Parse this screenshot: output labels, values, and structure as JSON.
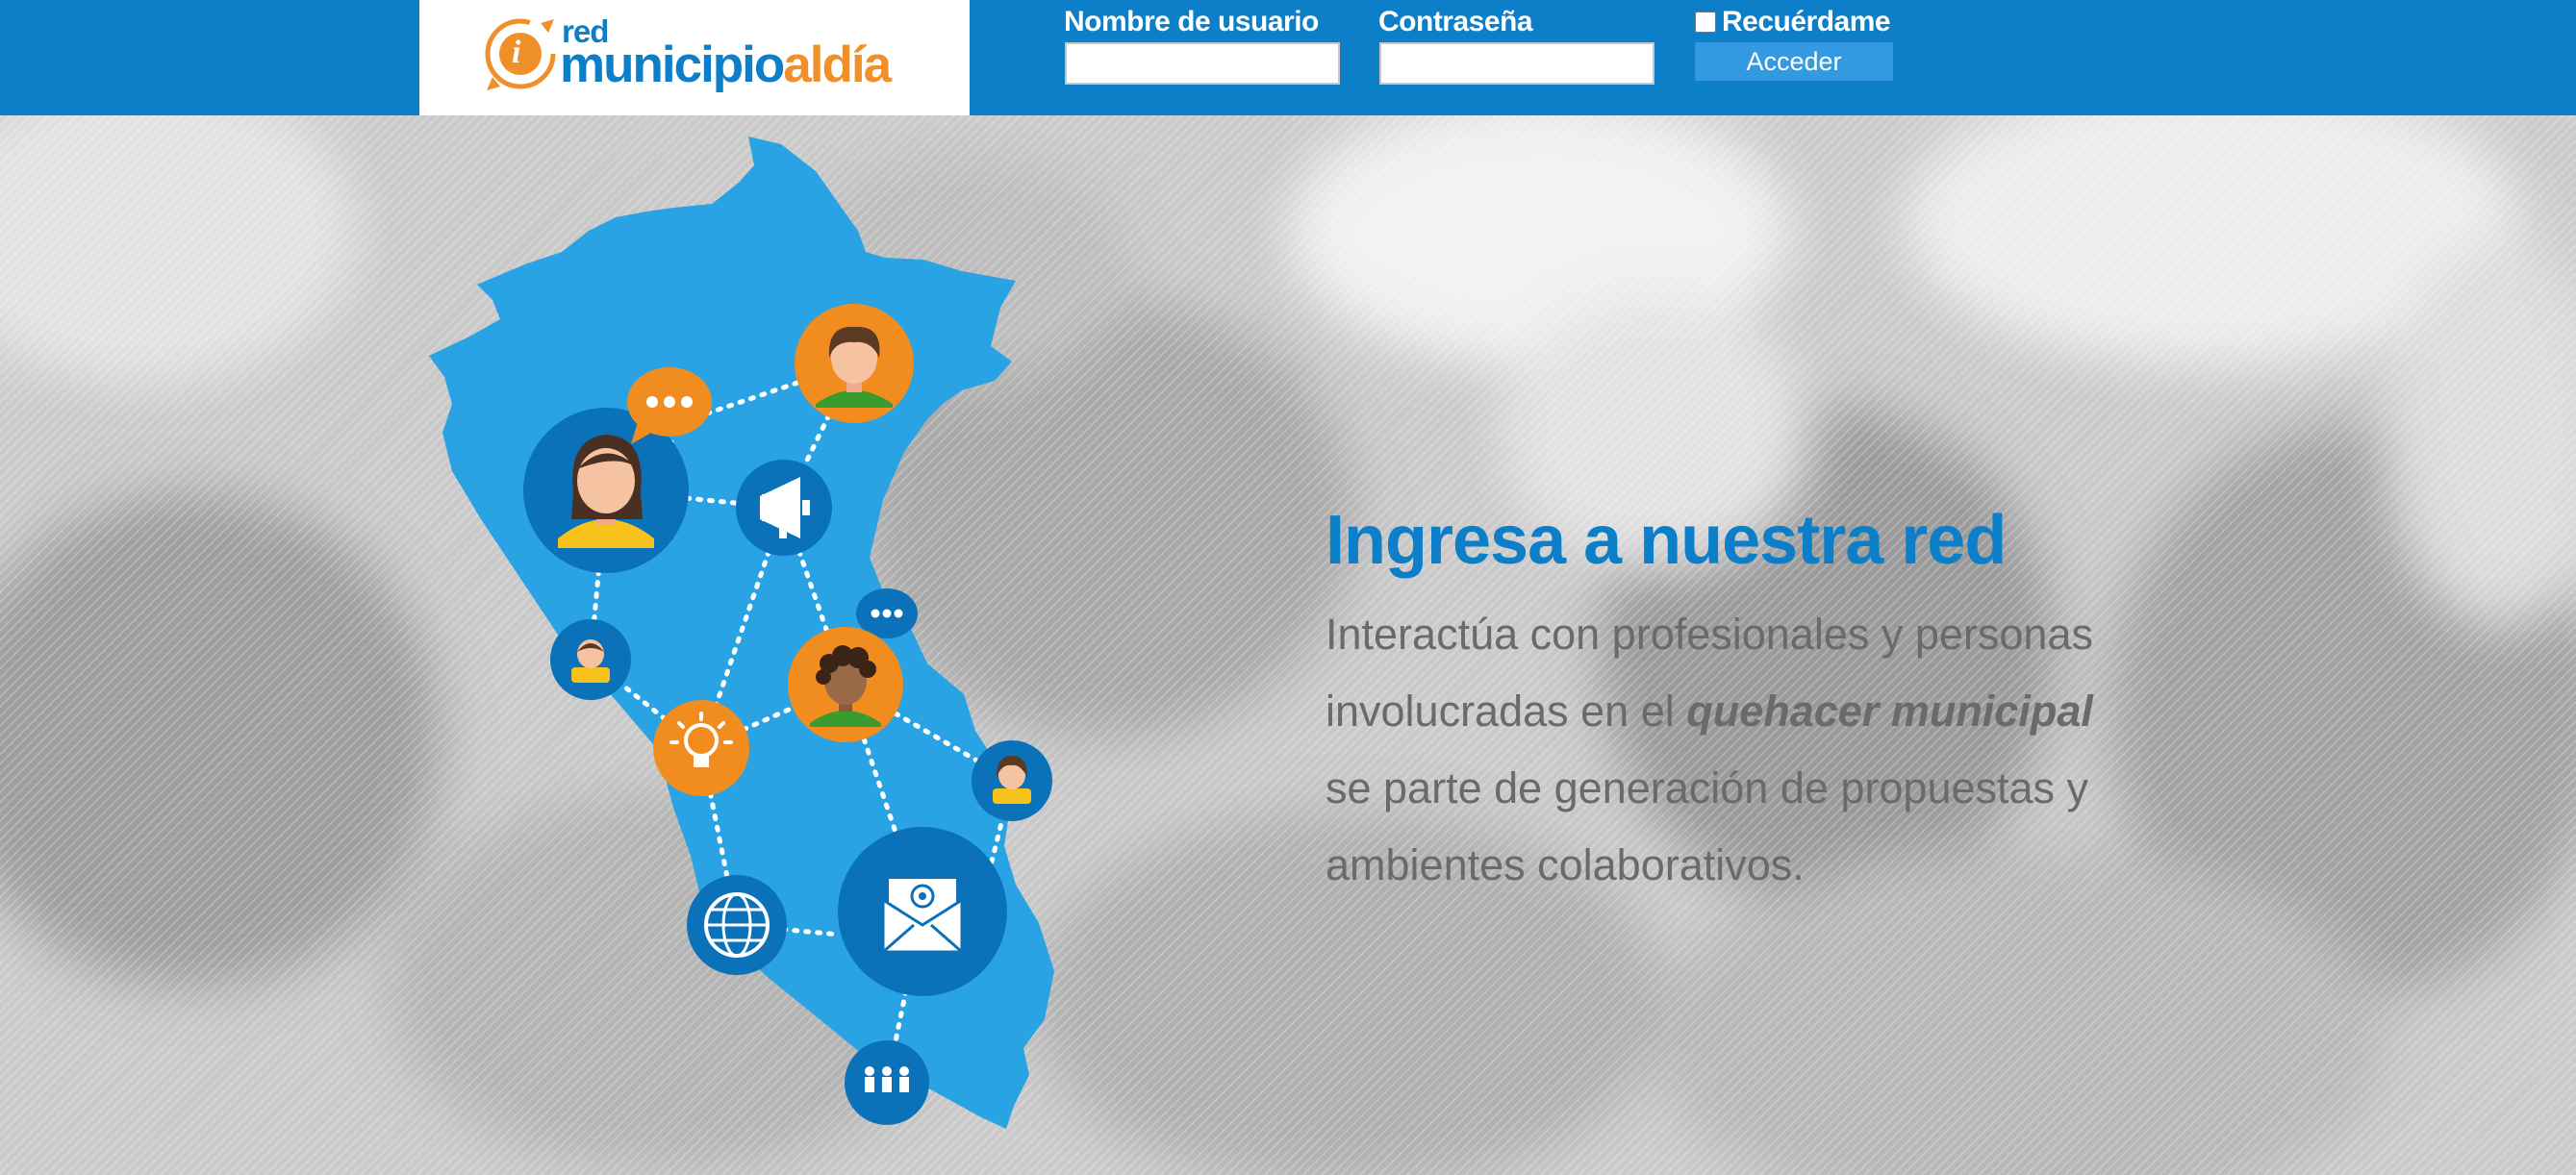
{
  "brand": {
    "logo_small": "red",
    "logo_part1": "municipio",
    "logo_part2": "aldía",
    "logo_badge": "i",
    "colors": {
      "primary": "#0c7fc8",
      "accent": "#f0902a",
      "map": "#29a3e4"
    }
  },
  "login": {
    "username_label": "Nombre de usuario",
    "username_value": "",
    "password_label": "Contraseña",
    "password_value": "",
    "remember_label": "Recuérdame",
    "remember_checked": false,
    "submit_label": "Acceder"
  },
  "hero": {
    "title": "Ingresa a nuestra red",
    "line1": "Interactúa con profesionales y personas",
    "line2_prefix": "involucradas en el ",
    "line2_emphasis": "quehacer municipal",
    "line3": "se parte de generación de propuestas y",
    "line4": "ambientes colaborativos."
  },
  "illustration": {
    "icons": [
      "person-female-icon",
      "person-male-icon",
      "chat-bubble-icon",
      "megaphone-icon",
      "lightbulb-icon",
      "globe-icon",
      "email-icon",
      "group-icon"
    ]
  }
}
